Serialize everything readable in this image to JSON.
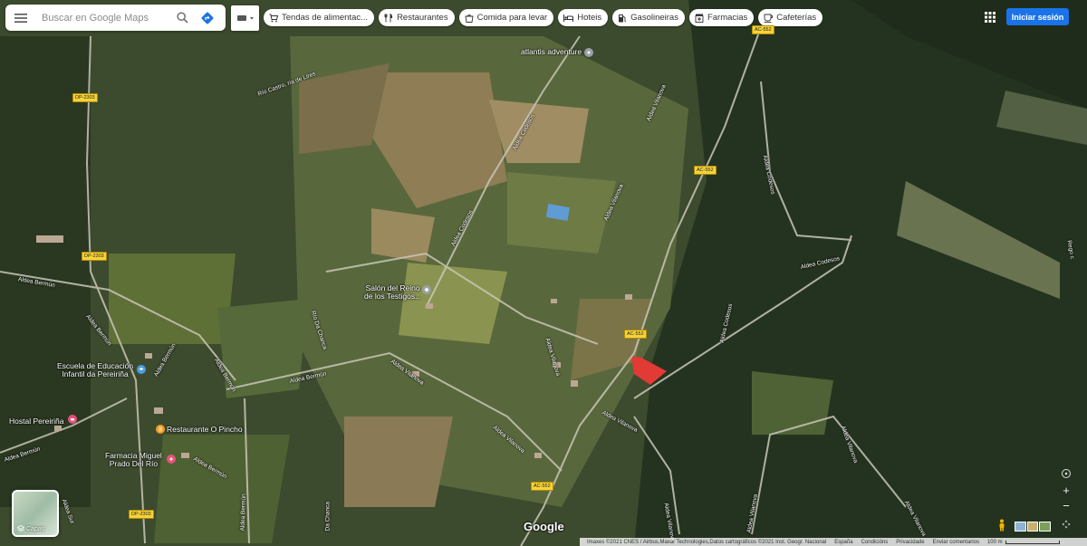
{
  "search": {
    "placeholder": "Buscar en Google Maps"
  },
  "categories": [
    {
      "label": "Tendas de alimentac...",
      "icon": "cart-icon"
    },
    {
      "label": "Restaurantes",
      "icon": "fork-knife-icon"
    },
    {
      "label": "Comida para levar",
      "icon": "takeout-icon"
    },
    {
      "label": "Hoteis",
      "icon": "bed-icon"
    },
    {
      "label": "Gasolineiras",
      "icon": "gas-pump-icon"
    },
    {
      "label": "Farmacias",
      "icon": "pharmacy-icon"
    },
    {
      "label": "Cafeterías",
      "icon": "coffee-icon"
    }
  ],
  "header": {
    "signin_label": "Iniciar sesión"
  },
  "layers": {
    "label": "Capas"
  },
  "zoom": {
    "in": "+",
    "out": "−"
  },
  "brand": "Google",
  "places": {
    "atlantis": "atlantis adventure",
    "salon_l1": "Salón del Reino",
    "salon_l2": "de los Testigos...",
    "escuela_l1": "Escuela de Educación",
    "escuela_l2": "Infantil da Pereiriña",
    "hostal": "Hostal Pereiriña",
    "restaurante": "Restaurante O Pincho",
    "farmacia_l1": "Farmacia Miguel",
    "farmacia_l2": "Prado Del Río"
  },
  "roads": {
    "rio_castro": "Río Castro, ría de Lires",
    "rio_chanca": "Río Da Chanca",
    "da_chanca": "Da Chanca",
    "aldea_codesos": "Aldea Codesos",
    "aldea_vilanova": "Aldea Vilanova",
    "aldea_bermun": "Aldea Bermún",
    "rego": "Rego c",
    "aldea_sur": "Aldea Sur"
  },
  "shields": {
    "dp2303": "DP-2303",
    "ac552": "AC-552"
  },
  "footer": {
    "imagery": "Imaxes ©2021 CNES / Airbus,Maxar Technologies,Datos cartográficos ©2021 Inst. Geogr. Nacional",
    "country": "España",
    "terms": "Condicións",
    "privacy": "Privacidade",
    "feedback": "Enviar comentarios",
    "scale": "100 m"
  }
}
